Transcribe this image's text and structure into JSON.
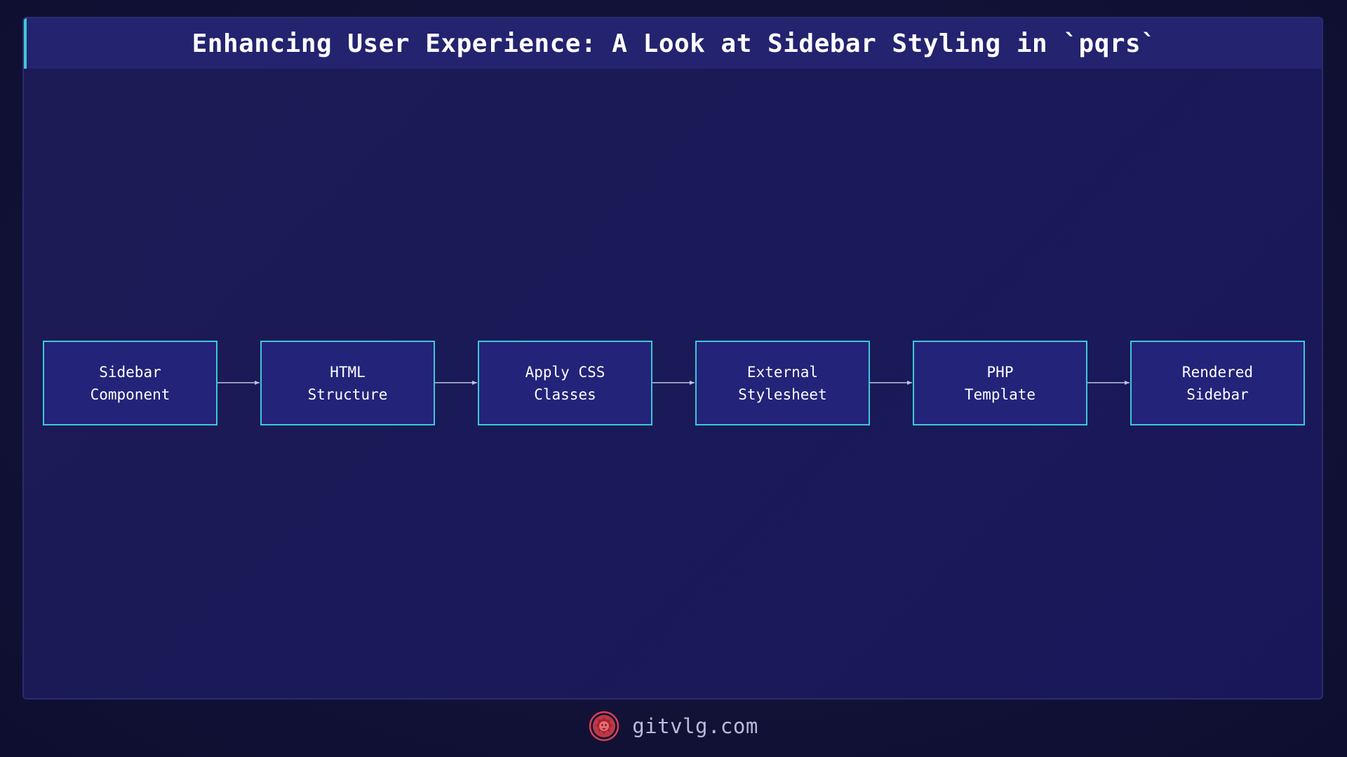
{
  "title": "Enhancing User Experience: A Look at Sidebar Styling in `pqrs`",
  "flow": {
    "nodes": [
      {
        "label": "Sidebar\nComponent"
      },
      {
        "label": "HTML\nStructure"
      },
      {
        "label": "Apply CSS\nClasses"
      },
      {
        "label": "External\nStylesheet"
      },
      {
        "label": "PHP\nTemplate"
      },
      {
        "label": "Rendered\nSidebar"
      }
    ]
  },
  "footer": {
    "site": "gitvlg.com",
    "logo_icon": "lion-head-icon"
  },
  "colors": {
    "accent": "#3ec9d6",
    "node_fill": "#23237a",
    "title_bar": "#232370",
    "logo": "#d9414a"
  }
}
